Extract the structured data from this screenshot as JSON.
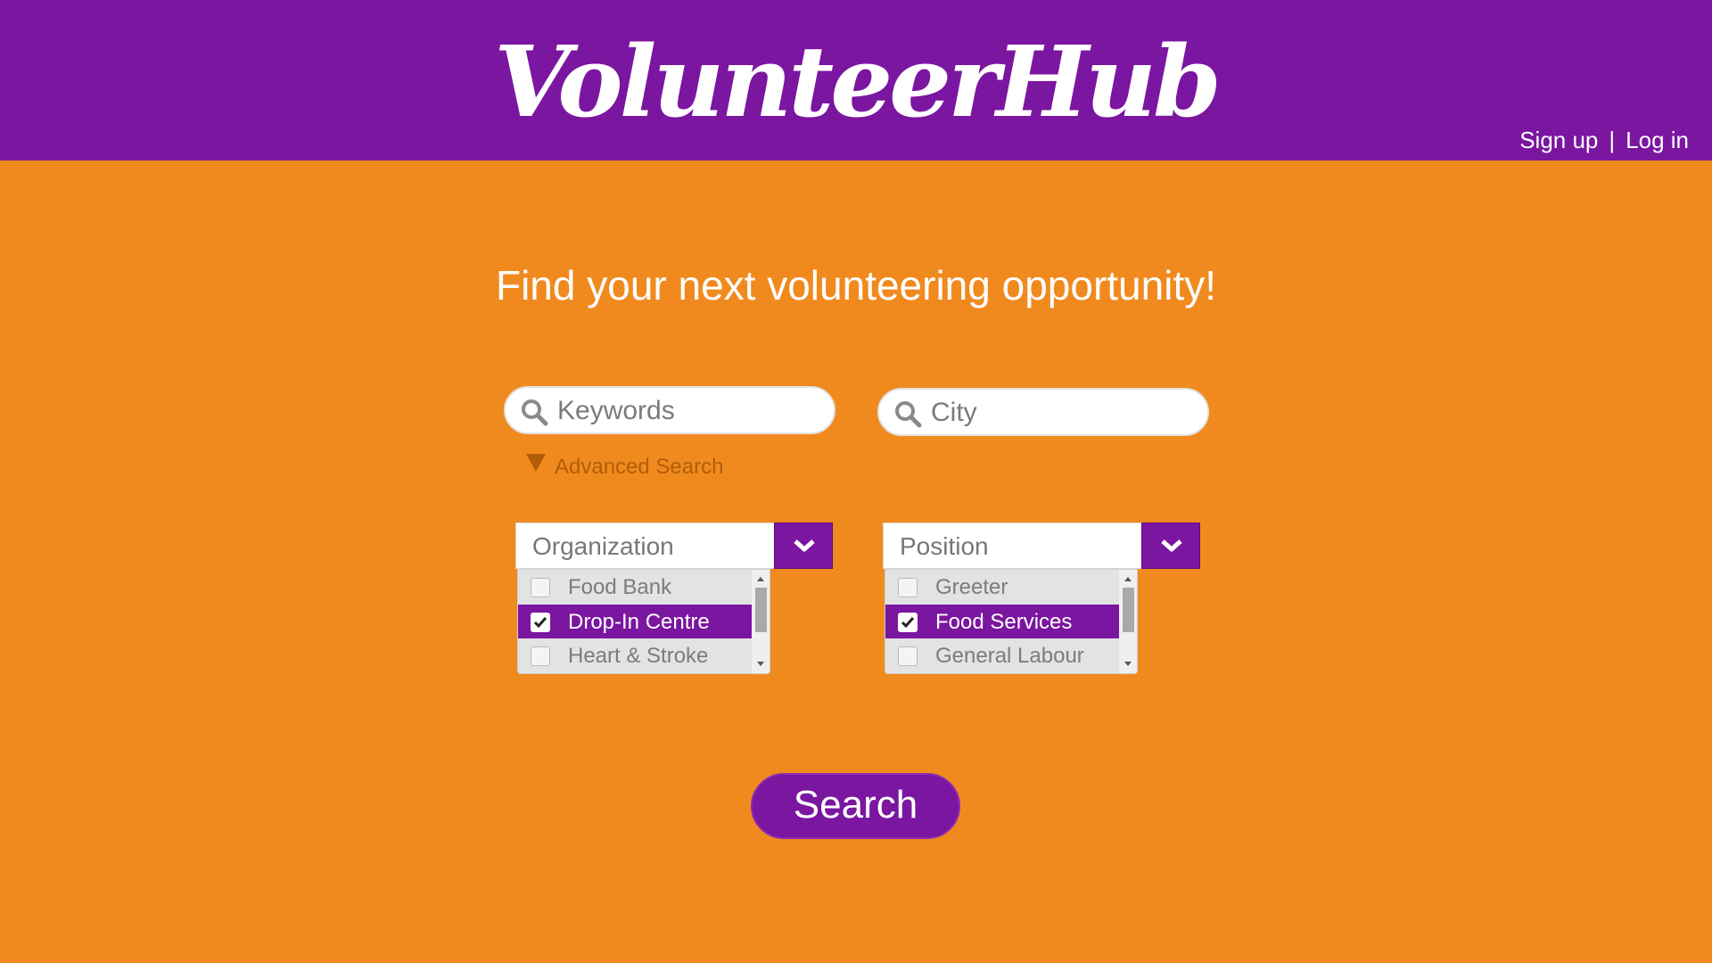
{
  "header": {
    "logo": "VolunteerHub",
    "signup_label": "Sign up",
    "separator": "|",
    "login_label": "Log in"
  },
  "main": {
    "headline": "Find your next volunteering opportunity!",
    "keywords": {
      "placeholder": "Keywords",
      "value": ""
    },
    "city": {
      "placeholder": "City",
      "value": ""
    },
    "advanced_search_label": "Advanced Search",
    "organization": {
      "label": "Organization",
      "options": [
        {
          "label": "Food Bank",
          "checked": false
        },
        {
          "label": "Drop-In Centre",
          "checked": true
        },
        {
          "label": "Heart & Stroke",
          "checked": false
        }
      ]
    },
    "position": {
      "label": "Position",
      "options": [
        {
          "label": "Greeter",
          "checked": false
        },
        {
          "label": "Food Services",
          "checked": true
        },
        {
          "label": "General Labour",
          "checked": false
        }
      ]
    },
    "search_button_label": "Search"
  },
  "colors": {
    "header_bg": "#7b16a0",
    "page_bg": "#f18a1e",
    "accent": "#7b16a0"
  }
}
